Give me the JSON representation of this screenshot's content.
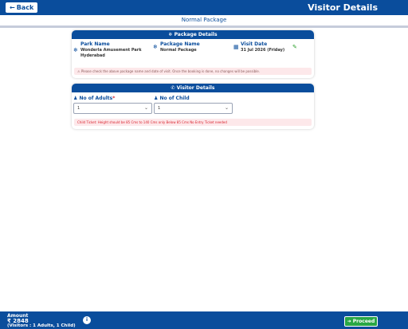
{
  "header": {
    "back_label": "Back",
    "title": "Visitor Details",
    "subtitle": "Normal Package"
  },
  "package_card": {
    "heading": "Package Details",
    "park": {
      "label": "Park Name",
      "value_line1": "Wonderla Amusement Park",
      "value_line2": "Hyderabad"
    },
    "package": {
      "label": "Package Name",
      "value": "Normal Package"
    },
    "visit": {
      "label": "Visit Date",
      "value": "31 Jul 2026 (Friday)"
    },
    "notice": "Please check the above package name and date of visit. Once the booking is done, no changes will be possible."
  },
  "visitor_card": {
    "heading": "Visitor Details",
    "adults": {
      "label": "No of Adults",
      "required_mark": "*",
      "value": "1"
    },
    "child": {
      "label": "No of Child",
      "value": "1"
    },
    "notice": "Child Ticket: Height should be 85 Cms to 140 Cms only Below 85 Cms No Entry Ticket needed"
  },
  "footer": {
    "amount_label": "Amount",
    "amount_value": "₹ 2848",
    "visitors_text": "(Visitors : 1 Adults, 1 Child)",
    "info_label": "i",
    "proceed_label": "Proceed"
  },
  "icons": {
    "back": "arrow-left-icon",
    "package_heading": "snowflake-icon",
    "park": "snowflake-icon",
    "package": "snowflake-icon",
    "visit": "calendar-icon",
    "edit": "edit-icon",
    "notice": "warning-icon",
    "visitor_heading": "phone-icon",
    "users": "users-icon",
    "select": "chevron-down-icon",
    "proceed": "arrow-right-icon"
  },
  "colors": {
    "brand": "#0a4d9c",
    "success": "#28a745",
    "danger": "#d9232e",
    "notice_bg": "#fde8ea"
  }
}
